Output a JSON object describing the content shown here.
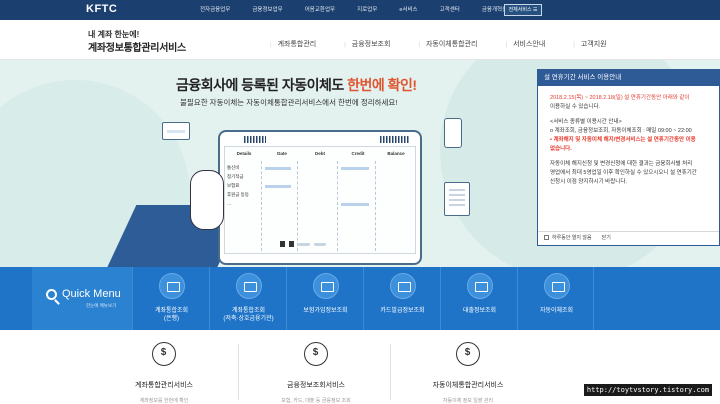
{
  "topbar": {
    "logo": "KFTC",
    "nav": [
      "전자금융업무",
      "금융정보업무",
      "어음교환업무",
      "지로업무",
      "e서비스",
      "고객센터",
      "금융개혁센터"
    ],
    "all_services": "전체서비스 ☰"
  },
  "header": {
    "brand_line1": "내 계좌 한눈에!",
    "brand_line2": "계좌정보통합관리서비스",
    "nav": [
      "계좌통합관리",
      "금융정보조회",
      "자동이체통합관리",
      "서비스안내",
      "고객지원"
    ]
  },
  "hero": {
    "title_prefix": "금융회사에 등록된 자동이체도 ",
    "title_highlight": "한번에 확인!",
    "subtitle": "불필요한 자동이체는 자동이체통합관리서비스에서 한번에 정리하세요!",
    "table_headers": [
      "Details",
      "Date",
      "Debt",
      "Credit",
      "Balance"
    ],
    "table_rows": [
      "통신비",
      "정기적금",
      "보험료",
      "후원금 등등",
      "…"
    ]
  },
  "notice": {
    "title": "설 연휴기간 서비스 이용안내",
    "period": "2018.2.15(목) ~ 2018.2.18(일) 설 연휴기간동안 아래와 같이",
    "line2": "이용하실 수 있습니다.",
    "section": "<서비스 종류별 이용시간 안내>",
    "item1": "o 계좌조회, 금융정보조회, 자동이체조회 : 매일 09:00 ~ 22:00",
    "item2": "• 계좌해지 및 자동이체 해지/변경서비스는 설 연휴기간동안 이용",
    "item2b": "없습니다.",
    "body1": "자동이체 해지신청 및 변경신청에 대한 결과는 금융회사별 처리",
    "body2": "영업에서 최대 5영업일 이후 확인하실 수 있으시오니 설 연휴기간",
    "body3": "신청시 이점 양지하시기 바랍니다.",
    "dont_show": "하루동안 열지 않음",
    "close": "닫기"
  },
  "quick_menu": {
    "title": "Quick Menu",
    "subtitle": "한눈에 메뉴보기",
    "items": [
      {
        "label": "계좌통합조회\n(은행)",
        "icon": "bank-icon"
      },
      {
        "label": "계좌통합조회\n(저축·상호금융기관)",
        "icon": "bank-card-icon"
      },
      {
        "label": "보험가입정보조회",
        "icon": "insurance-icon"
      },
      {
        "label": "카드발급정보조회",
        "icon": "credit-card-icon"
      },
      {
        "label": "대출정보조회",
        "icon": "loan-icon"
      },
      {
        "label": "자동이체조회",
        "icon": "auto-transfer-icon"
      }
    ]
  },
  "services": [
    {
      "title": "계좌통합관리서비스",
      "desc": "계좌정보를 한번에 확인",
      "icon": "money-bag-icon"
    },
    {
      "title": "금융정보조회서비스",
      "desc": "보험, 카드, 대출 등 금융정보 조회",
      "icon": "chart-magnifier-icon"
    },
    {
      "title": "자동이체통합관리서비스",
      "desc": "자동이체 정보 일괄 관리",
      "icon": "hand-coin-icon"
    }
  ],
  "watermark": "http://toytvstory.tistory.com",
  "colors": {
    "topbar": "#1b3f6e",
    "quickbar": "#1f74c8",
    "hero_bg": "#e3f1ef",
    "accent_red": "#e0542f",
    "notice_header": "#2e5a96"
  }
}
